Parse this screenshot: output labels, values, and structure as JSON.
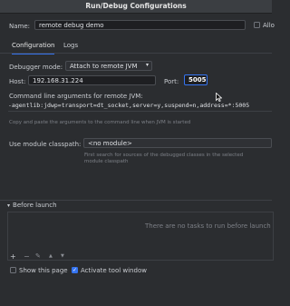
{
  "window": {
    "title": "Run/Debug Configurations"
  },
  "name_row": {
    "label": "Name:",
    "value": "remote debug demo",
    "allow_label": "Allo"
  },
  "tabs": [
    {
      "label": "Configuration"
    },
    {
      "label": "Logs"
    }
  ],
  "debugger_mode": {
    "label": "Debugger mode:",
    "value": "Attach to remote JVM"
  },
  "host": {
    "label": "Host:",
    "value": "192.168.31.224"
  },
  "port": {
    "label": "Port:",
    "value": "5005"
  },
  "cmdline": {
    "label": "Command line arguments for remote JVM:",
    "value": "-agentlib:jdwp=transport=dt_socket,server=y,suspend=n,address=*:5005",
    "hint": "Copy and paste the arguments to the command line when JVM is started"
  },
  "module_classpath": {
    "label": "Use module classpath:",
    "value": "<no module>",
    "hint_line1": "First search for sources of the debugged classes in the selected",
    "hint_line2": "module classpath"
  },
  "before_launch": {
    "label": "Before launch",
    "empty_text": "There are no tasks to run before launch",
    "toolbar": {
      "add": "+",
      "remove": "−",
      "edit": "✎",
      "up": "▲",
      "down": "▼"
    }
  },
  "footer": {
    "show_page_label": "Show this page",
    "activate_label": "Activate tool window",
    "activate_checked": true,
    "show_page_checked": false
  },
  "colors": {
    "accent": "#3574f0",
    "background": "#2b2d30"
  }
}
